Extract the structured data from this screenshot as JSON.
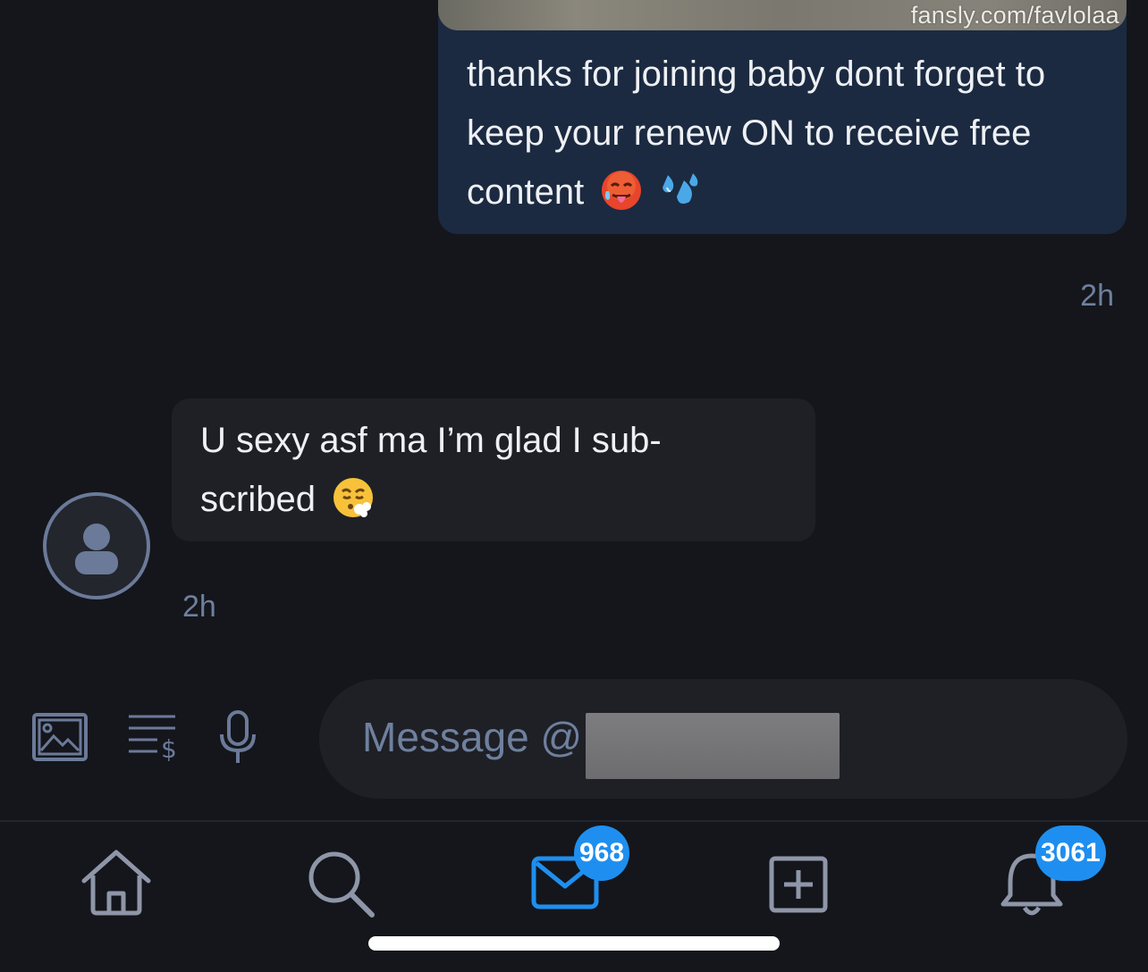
{
  "outgoing_message": {
    "watermark": "fansly.com/favlolaa",
    "text": "thanks for joining  baby dont forget to keep your renew ON to receive free content",
    "emojis": [
      "hot-face-emoji",
      "sweat-droplets-emoji"
    ],
    "time": "2h"
  },
  "incoming_message": {
    "text": "U sexy asf ma I’m glad I sub-scribed",
    "emojis": [
      "exhaling-face-emoji"
    ],
    "time": "2h",
    "avatar": "default-user-icon"
  },
  "composer": {
    "placeholder": "Message @",
    "tools": [
      "image-icon",
      "price-list-icon",
      "microphone-icon"
    ]
  },
  "nav": {
    "items": [
      {
        "icon": "home-icon"
      },
      {
        "icon": "search-icon"
      },
      {
        "icon": "messages-icon",
        "badge": "968"
      },
      {
        "icon": "add-post-icon"
      },
      {
        "icon": "notifications-icon",
        "badge": "3061"
      }
    ],
    "accent": "#1e8ff0"
  }
}
